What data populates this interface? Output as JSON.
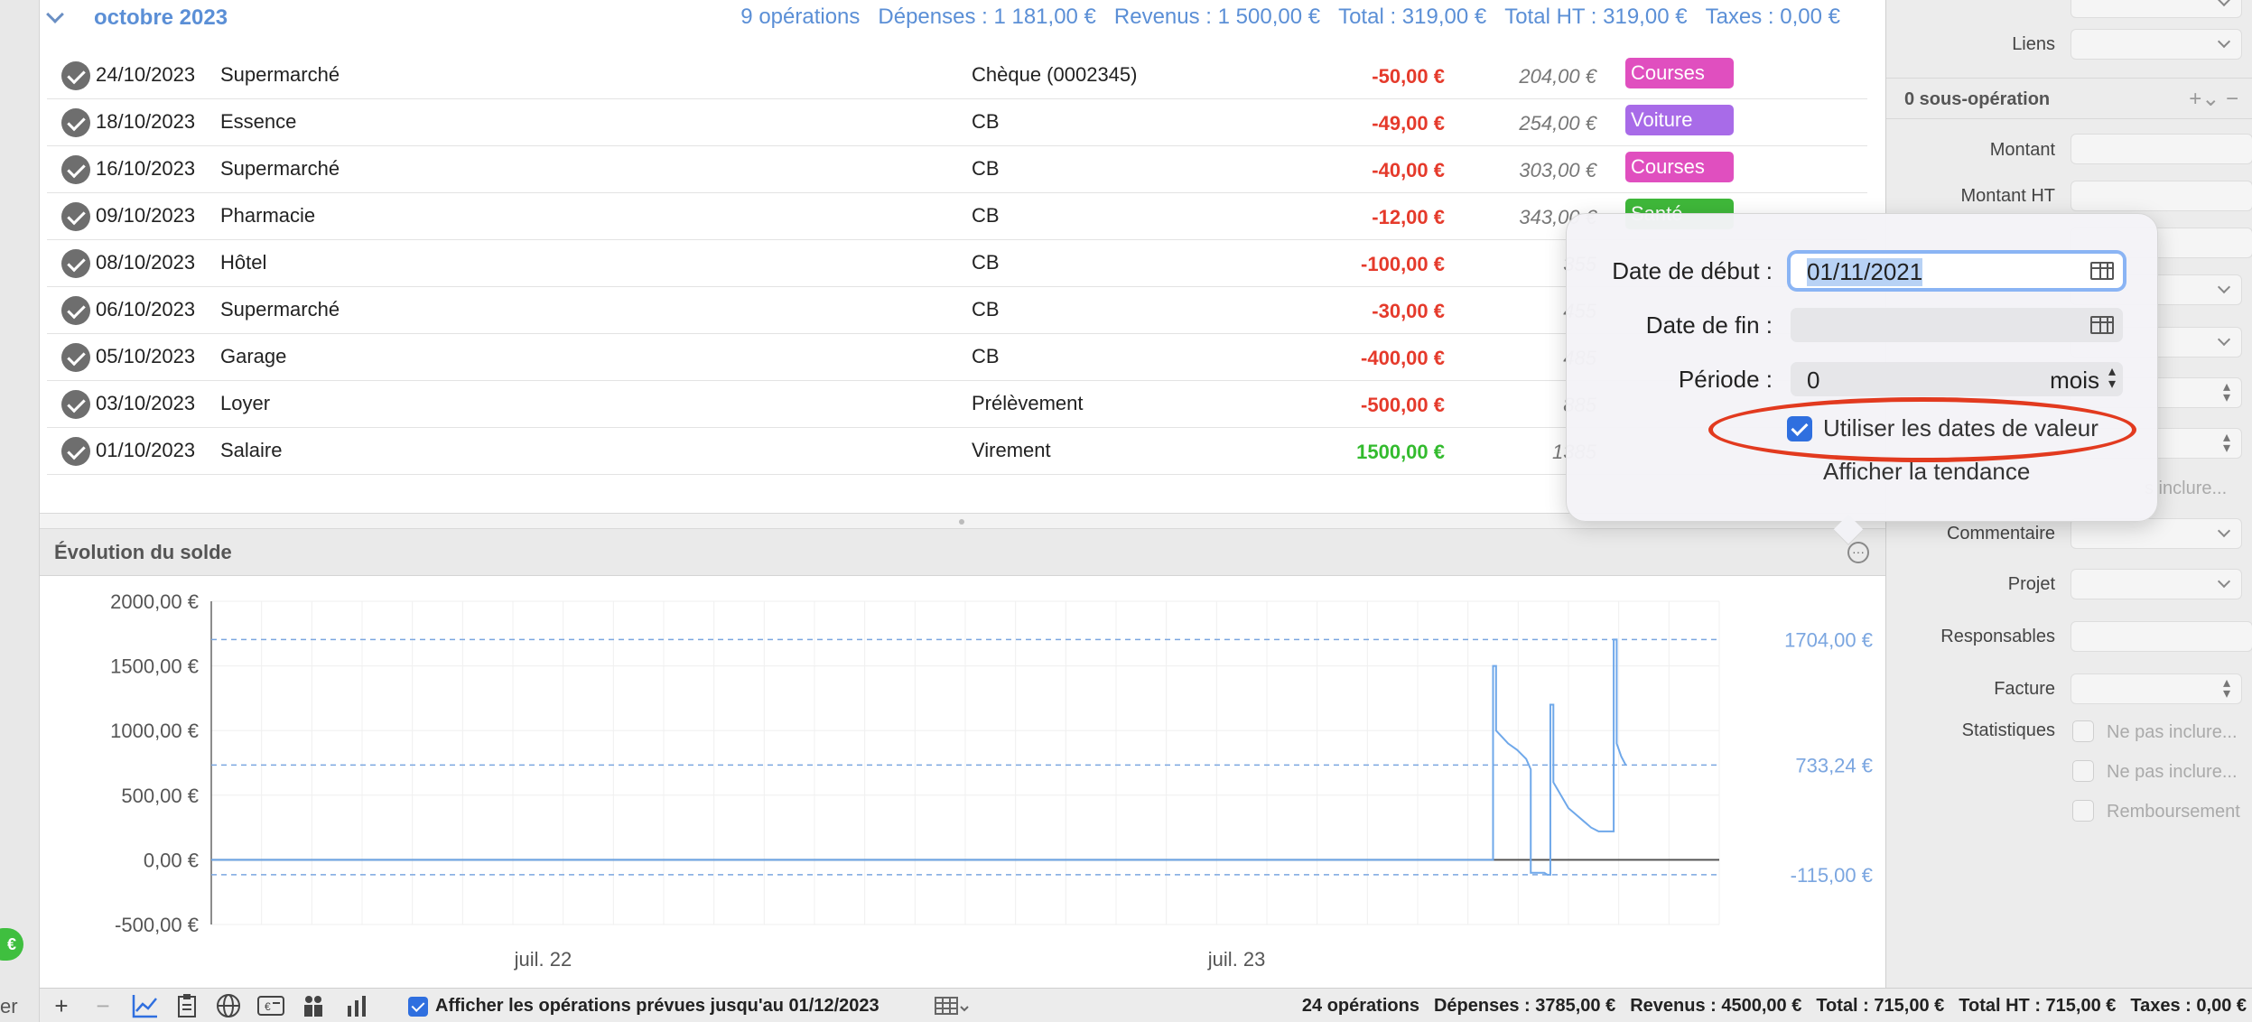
{
  "month_section": {
    "title": "octobre 2023",
    "summary": [
      "9 opérations",
      "Dépenses : 1 181,00 €",
      "Revenus : 1 500,00 €",
      "Total : 319,00 €",
      "Total HT : 319,00 €",
      "Taxes : 0,00 €"
    ]
  },
  "operations": [
    {
      "date": "24/10/2023",
      "label": "Supermarché",
      "mode": "Chèque (0002345)",
      "amount": "-50,00 €",
      "balance": "204,00 €",
      "tag": "Courses",
      "tag_color": "#e04fbf",
      "positive": false
    },
    {
      "date": "18/10/2023",
      "label": "Essence",
      "mode": "CB",
      "amount": "-49,00 €",
      "balance": "254,00 €",
      "tag": "Voiture",
      "tag_color": "#a86be8",
      "positive": false
    },
    {
      "date": "16/10/2023",
      "label": "Supermarché",
      "mode": "CB",
      "amount": "-40,00 €",
      "balance": "303,00 €",
      "tag": "Courses",
      "tag_color": "#e04fbf",
      "positive": false
    },
    {
      "date": "09/10/2023",
      "label": "Pharmacie",
      "mode": "CB",
      "amount": "-12,00 €",
      "balance": "343,00 €",
      "tag": "Santé",
      "tag_color": "#3fb83a",
      "positive": false
    },
    {
      "date": "08/10/2023",
      "label": "Hôtel",
      "mode": "CB",
      "amount": "-100,00 €",
      "balance": "355",
      "tag": "",
      "tag_color": "",
      "positive": false
    },
    {
      "date": "06/10/2023",
      "label": "Supermarché",
      "mode": "CB",
      "amount": "-30,00 €",
      "balance": "455",
      "tag": "",
      "tag_color": "",
      "positive": false
    },
    {
      "date": "05/10/2023",
      "label": "Garage",
      "mode": "CB",
      "amount": "-400,00 €",
      "balance": "485",
      "tag": "",
      "tag_color": "",
      "positive": false
    },
    {
      "date": "03/10/2023",
      "label": "Loyer",
      "mode": "Prélèvement",
      "amount": "-500,00 €",
      "balance": "885",
      "tag": "",
      "tag_color": "",
      "positive": false
    },
    {
      "date": "01/10/2023",
      "label": "Salaire",
      "mode": "Virement",
      "amount": "1500,00 €",
      "balance": "1385",
      "tag": "",
      "tag_color": "",
      "positive": true
    }
  ],
  "chart_panel": {
    "title": "Évolution du solde",
    "more_icon": "ellipsis-circle-icon"
  },
  "chart_data": {
    "type": "line",
    "y_ticks": [
      "2000,00 €",
      "1500,00 €",
      "1000,00 €",
      "500,00 €",
      "0,00 €",
      "-500,00 €"
    ],
    "y_tick_values": [
      2000,
      1500,
      1000,
      500,
      0,
      -500
    ],
    "ylim": [
      -500,
      2000
    ],
    "x_ticks": [
      "juil. 22",
      "juil. 23"
    ],
    "reference_lines": [
      {
        "label": "1704,00 €",
        "value": 1704
      },
      {
        "label": "733,24 €",
        "value": 733.24
      },
      {
        "label": "-115,00 €",
        "value": -115
      }
    ],
    "series": [
      {
        "color": "#6fa8ea",
        "points": [
          [
            0,
            0
          ],
          [
            0.85,
            0
          ],
          [
            0.85,
            1500
          ],
          [
            0.852,
            1500
          ],
          [
            0.852,
            1000
          ],
          [
            0.856,
            950
          ],
          [
            0.86,
            900
          ],
          [
            0.866,
            850
          ],
          [
            0.872,
            780
          ],
          [
            0.875,
            700
          ],
          [
            0.875,
            -100
          ],
          [
            0.884,
            -100
          ],
          [
            0.886,
            -115
          ],
          [
            0.888,
            -115
          ],
          [
            0.888,
            1200
          ],
          [
            0.89,
            1200
          ],
          [
            0.89,
            600
          ],
          [
            0.9,
            400
          ],
          [
            0.905,
            350
          ],
          [
            0.91,
            300
          ],
          [
            0.915,
            250
          ],
          [
            0.92,
            220
          ],
          [
            0.93,
            220
          ],
          [
            0.93,
            1704
          ],
          [
            0.932,
            1704
          ],
          [
            0.932,
            900
          ],
          [
            0.935,
            800
          ],
          [
            0.938,
            733
          ]
        ]
      }
    ],
    "grid": true
  },
  "bottom_toolbar": {
    "add_icon": "plus-icon",
    "remove_icon": "minus-icon",
    "chart_icon": "line-chart-icon",
    "clipboard_icon": "clipboard-icon",
    "globe_icon": "globe-icon",
    "card_icon": "card-icon",
    "people_icon": "people-icon",
    "bars_icon": "bar-chart-icon",
    "show_planned_label": "Afficher les opérations prévues jusqu'au 01/12/2023",
    "show_planned_checked": true,
    "totals": [
      "24 opérations",
      "Dépenses : 3785,00 €",
      "Revenus : 4500,00 €",
      "Total : 715,00 €",
      "Total HT : 715,00 €",
      "Taxes : 0,00 €"
    ]
  },
  "right_panel": {
    "links_label": "Liens",
    "suboperations_title": "0 sous-opération",
    "amount_label": "Montant",
    "amount_ht_label": "Montant HT",
    "include_label_truncated": "s inclure...",
    "comment_label": "Commentaire",
    "project_label": "Projet",
    "responsibles_label": "Responsables",
    "invoice_label": "Facture",
    "statistics_label": "Statistiques",
    "stat_options": [
      "Ne pas inclure...",
      "Ne pas inclure...",
      "Remboursement"
    ]
  },
  "popover": {
    "start_label": "Date de début :",
    "start_value": "01/11/2021",
    "end_label": "Date de fin :",
    "end_value": "",
    "period_label": "Période :",
    "period_value": "0",
    "period_unit": "mois",
    "use_value_dates_label": "Utiliser les dates de valeur",
    "use_value_dates_checked": true,
    "show_trend_label": "Afficher la tendance",
    "calendar_icon": "calendar-icon"
  },
  "left_strip": {
    "badge": "€",
    "text": "er"
  }
}
